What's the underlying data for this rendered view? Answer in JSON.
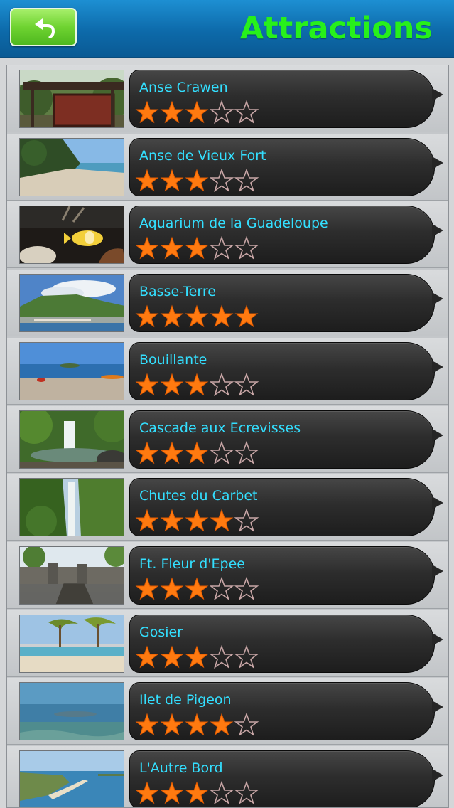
{
  "header": {
    "title": "Attractions",
    "back_icon": "back-arrow-icon"
  },
  "colors": {
    "nav_bar": "#0d6aaa",
    "title": "#27f01b",
    "back_button": "#6fd331",
    "item_title": "#33dfff",
    "star_filled": "#ff7a10",
    "star_empty_outline": "#c9a7a7"
  },
  "rating_max": 5,
  "attractions": [
    {
      "name": "Anse Crawen",
      "rating": 3,
      "photo": "signboard"
    },
    {
      "name": "Anse de Vieux Fort",
      "rating": 3,
      "photo": "beach"
    },
    {
      "name": "Aquarium de la Guadeloupe",
      "rating": 3,
      "photo": "aquarium"
    },
    {
      "name": "Basse-Terre",
      "rating": 5,
      "photo": "town-and-hills"
    },
    {
      "name": "Bouillante",
      "rating": 3,
      "photo": "beach-kayak"
    },
    {
      "name": "Cascade aux Ecrevisses",
      "rating": 3,
      "photo": "waterfall-pool"
    },
    {
      "name": "Chutes du Carbet",
      "rating": 4,
      "photo": "tall-waterfall"
    },
    {
      "name": "Ft. Fleur d'Epee",
      "rating": 3,
      "photo": "fort-ruins"
    },
    {
      "name": "Gosier",
      "rating": 3,
      "photo": "palm-beach"
    },
    {
      "name": "Ilet de Pigeon",
      "rating": 4,
      "photo": "underwater"
    },
    {
      "name": "L'Autre Bord",
      "rating": 3,
      "photo": "coastline"
    }
  ]
}
